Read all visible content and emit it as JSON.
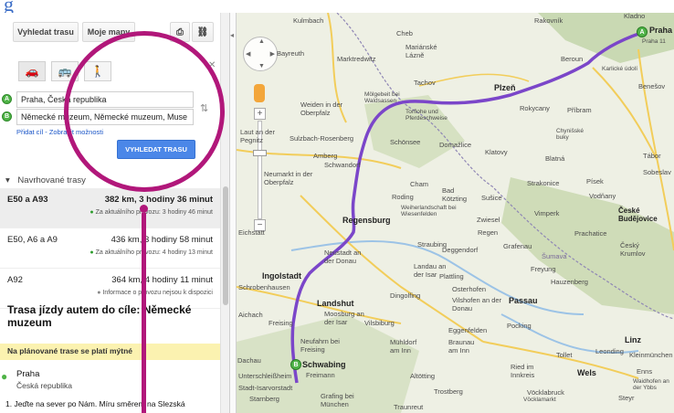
{
  "header": {
    "logo_fragment": "g"
  },
  "toolbar": {
    "route_button": "Vyhledat trasu",
    "my_maps_button": "Moje mapy",
    "print_icon": "print-icon",
    "link_icon": "link-icon"
  },
  "modes": [
    {
      "name": "car-icon",
      "glyph": "🚗"
    },
    {
      "name": "transit-icon",
      "glyph": "🚌"
    },
    {
      "name": "walk-icon",
      "glyph": "🚶"
    }
  ],
  "directions_form": {
    "from_marker": "A",
    "to_marker": "B",
    "from_value": "Praha, Česká republika",
    "to_value": "Německé muzeum, Německé muzeum, Muse",
    "add_links": "Přidat cíl - Zobrazit možnosti",
    "submit": "VYHLEDAT TRASU"
  },
  "suggested": {
    "header": "Navrhované trasy",
    "routes": [
      {
        "name": "E50 a A93",
        "distance": "382 km, 3 hodiny 36 minut",
        "traffic": "Za aktuálního provozu: 3 hodiny 46 minut"
      },
      {
        "name": "E50, A6 a A9",
        "distance": "436 km, 3 hodiny 58 minut",
        "traffic": "Za aktuálního provozu: 4 hodiny 13 minut"
      },
      {
        "name": "A92",
        "distance": "364 km, 4 hodiny 11 minut",
        "traffic": "Informace o provozu nejsou k dispozici"
      }
    ]
  },
  "itinerary": {
    "title": "Trasa jízdy autem do cíle: Německé muzeum",
    "notice": "Na plánované trase se platí mýtné",
    "start_name": "Praha",
    "start_sub": "Česká republika",
    "step1": "1. Jeďte na sever po Nám. Míru směrem na Slezská"
  },
  "map": {
    "route_color": "#7b46c9",
    "labels": [
      "Kulmbach",
      "Bayreuth",
      "Marktredwitz",
      "Cheb",
      "Mariánské Lázně",
      "Tachov",
      "Weiden in der Oberpfalz",
      "Mölgebeit bei Waldsassen",
      "Torflohe und Pferdeschweise",
      "Plzeň",
      "Rokycany",
      "Beroun",
      "Karlické údolí",
      "Benešov",
      "Příbram",
      "Chynišské buky",
      "Blatná",
      "Tábor",
      "Sulzbach-Rosenberg",
      "Amberg",
      "Schwandorf",
      "Schönsee",
      "Domažlice",
      "Klatovy",
      "Písek",
      "Sobeslav",
      "Neumarkt in der Oberpfalz",
      "Regensburg",
      "Roding",
      "Cham",
      "Bad Kötzting",
      "Sušice",
      "Strakonice",
      "Vodňany",
      "Weiherlandschaft bei Wiesenfelden",
      "Zwiesel",
      "Regen",
      "Vimperk",
      "Prachatice",
      "České Budějovice",
      "Ingolstadt",
      "Neustadt an der Donau",
      "Straubing",
      "Deggendorf",
      "Grafenau",
      "Šumava",
      "Český Krumlov",
      "Landau an der Isar",
      "Plattling",
      "Freyung",
      "Hauzenberg",
      "Osterhofen",
      "Vilshofen an der Donau",
      "Passau",
      "Dingolfing",
      "Landshut",
      "Moosburg an der Isar",
      "Vilsbiburg",
      "Eggenfelden",
      "Pocking",
      "Freising",
      "Neufahrn bei Freising",
      "Mühldorf am Inn",
      "Braunau am Inn",
      "Ried im Innkreis",
      "Linz",
      "Kleinmünchen",
      "Leonding",
      "Enns",
      "Wels",
      "Steyr",
      "Dachau",
      "Unterschleißheim",
      "Schwabing",
      "Freimann",
      "Altötting",
      "Trostberg",
      "Vöcklabruck",
      "Grafing bei München",
      "Traunreut",
      "Starnberg",
      "Waidhofen an der Ybbs",
      "Rakovník",
      "Kladno",
      "Praha",
      "Praha 11",
      "Eichstätt",
      "Schrobenhausen",
      "Aichach",
      "Laut an der Pegnitz",
      "Tollet",
      "Vöcklamarkt",
      "Stadt-Isarvorstadt"
    ]
  },
  "annotation": {
    "color": "#b1177a"
  }
}
